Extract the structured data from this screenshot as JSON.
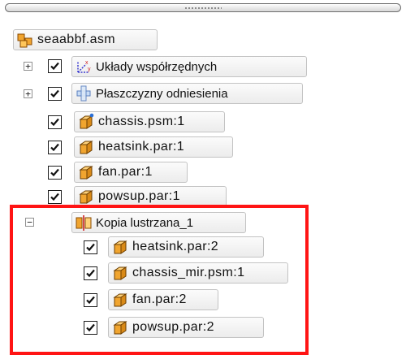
{
  "tree": {
    "root": {
      "label": "seaabbf.asm",
      "icon": "assembly-icon"
    },
    "nodes": [
      {
        "label": "Układy współrzędnych",
        "icon": "coordinate-system-icon",
        "expander": "+",
        "checked": true
      },
      {
        "label": "Płaszczyzny odniesienia",
        "icon": "reference-plane-icon",
        "expander": "+",
        "checked": true
      },
      {
        "label": "chassis.psm:1",
        "icon": "sheetmetal-part-icon",
        "checked": true
      },
      {
        "label": "heatsink.par:1",
        "icon": "part-icon",
        "checked": true
      },
      {
        "label": "fan.par:1",
        "icon": "part-icon",
        "checked": true
      },
      {
        "label": "powsup.par:1",
        "icon": "part-icon",
        "checked": true
      },
      {
        "label": "Kopia lustrzana_1",
        "icon": "mirror-copy-icon",
        "expander": "−"
      },
      {
        "label": "heatsink.par:2",
        "icon": "part-icon",
        "checked": true
      },
      {
        "label": "chassis_mir.psm:1",
        "icon": "part-icon",
        "checked": true
      },
      {
        "label": "fan.par:2",
        "icon": "part-icon",
        "checked": true
      },
      {
        "label": "powsup.par:2",
        "icon": "part-icon",
        "checked": true
      }
    ]
  },
  "colors": {
    "highlight": "#ff1414",
    "part_icon": "#f1a52f"
  }
}
